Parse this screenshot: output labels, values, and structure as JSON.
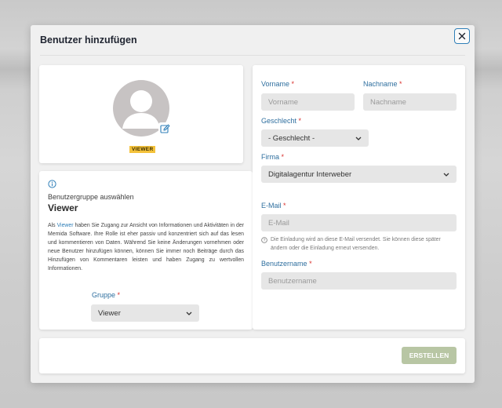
{
  "modal": {
    "title": "Benutzer hinzufügen",
    "close_icon": "close-icon"
  },
  "avatar": {
    "icon": "user-placeholder-icon",
    "edit_icon": "edit-icon",
    "role_badge": "VIEWER"
  },
  "info": {
    "icon": "info-icon",
    "label": "Benutzergruppe auswählen",
    "heading": "Viewer",
    "text_prefix": "Als ",
    "text_link": "Viewer",
    "text_body": " haben Sie Zugang zur Ansicht von Informationen und Aktivitäten in der Memida Software. Ihre Rolle ist eher passiv und konzentriert sich auf das lesen und kommentieren von Daten. Während Sie keine Änderungen vornehmen oder neue Benutzer hinzufügen können, können Sie immer noch Beiträge durch das Hinzufügen von Kommentaren leisten und haben Zugang zu wertvollen Informationen.",
    "group_label": "Gruppe",
    "group_value": "Viewer"
  },
  "form": {
    "required_mark": "*",
    "firstname_label": "Vorname",
    "firstname_placeholder": "Vorname",
    "lastname_label": "Nachname",
    "lastname_placeholder": "Nachname",
    "gender_label": "Geschlecht",
    "gender_value": "- Geschlecht -",
    "company_label": "Firma",
    "company_value": "Digitalagentur Interweber",
    "email_label": "E-Mail",
    "email_placeholder": "E-Mail",
    "email_hint": "Die Einladung wird an diese E-Mail versendet. Sie können diese später ändern oder die Einladung erneut versenden.",
    "username_label": "Benutzername",
    "username_placeholder": "Benutzername"
  },
  "footer": {
    "create_label": "ERSTELLEN"
  },
  "colors": {
    "accent": "#2f7fb8",
    "required": "#d9302c",
    "badge": "#f4c23b",
    "create_button": "#b8c6a4"
  }
}
